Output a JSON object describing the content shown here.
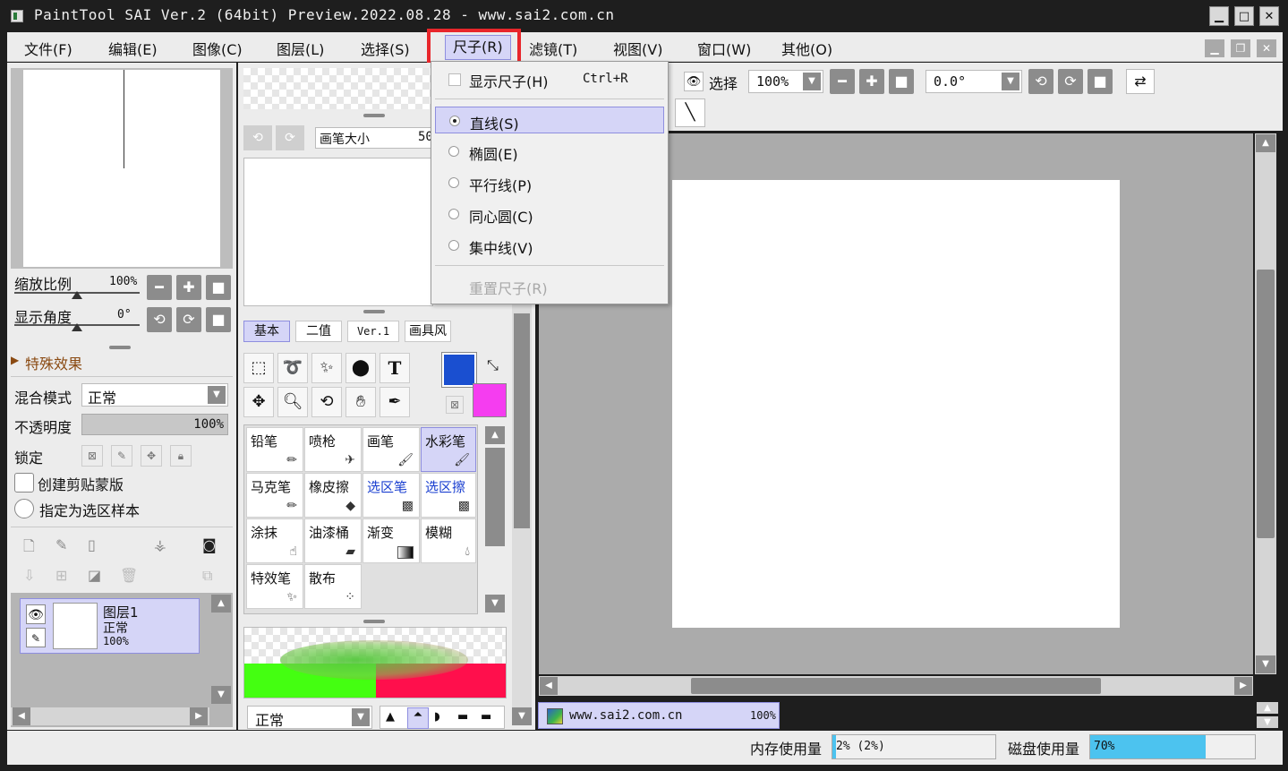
{
  "window": {
    "title": "PaintTool SAI Ver.2 (64bit) Preview.2022.08.28 - www.sai2.com.cn"
  },
  "menu": {
    "items": [
      "文件(F)",
      "编辑(E)",
      "图像(C)",
      "图层(L)",
      "选择(S)",
      "尺子(R)",
      "滤镜(T)",
      "视图(V)",
      "窗口(W)",
      "其他(O)"
    ]
  },
  "ruler_menu": {
    "show": "显示尺子(H)",
    "show_shortcut": "Ctrl+R",
    "line": "直线(S)",
    "ellipse": "椭圆(E)",
    "parallel": "平行线(P)",
    "concentric": "同心圆(C)",
    "focus": "集中线(V)",
    "reset": "重置尺子(R)"
  },
  "navigator": {
    "zoom_label": "缩放比例",
    "zoom_value": "100%",
    "angle_label": "显示角度",
    "angle_value": "0°",
    "effects_label": "特殊效果"
  },
  "layer_props": {
    "blend_label": "混合模式",
    "blend_value": "正常",
    "opacity_label": "不透明度",
    "opacity_value": "100%",
    "lock_label": "锁定",
    "clip_label": "创建剪贴蒙版",
    "sample_label": "指定为选区样本"
  },
  "layer": {
    "name": "图层1",
    "mode": "正常",
    "opacity": "100%"
  },
  "brush": {
    "size_label": "画笔大小",
    "size_value": "50"
  },
  "tool_tabs": [
    "基本",
    "二值",
    "Ver.1",
    "画具风"
  ],
  "tools": [
    "铅笔",
    "喷枪",
    "画笔",
    "水彩笔",
    "马克笔",
    "橡皮擦",
    "选区笔",
    "选区擦",
    "涂抹",
    "油漆桶",
    "渐变",
    "模糊",
    "特效笔",
    "散布"
  ],
  "brush_blend": "正常",
  "toolbar": {
    "select_label": "选择",
    "zoom": "100%",
    "angle": "0.0°"
  },
  "colors": {
    "primary": "#1a4fd0",
    "secondary": "#f53df0",
    "accent": "#e8262b",
    "selected": "#d5d5f7"
  },
  "doc_tab": {
    "name": "www.sai2.com.cn",
    "zoom": "100%"
  },
  "status": {
    "mem_label": "内存使用量",
    "mem_value": "2% (2%)",
    "mem_pct": 2,
    "disk_label": "磁盘使用量",
    "disk_value": "70%",
    "disk_pct": 70
  }
}
